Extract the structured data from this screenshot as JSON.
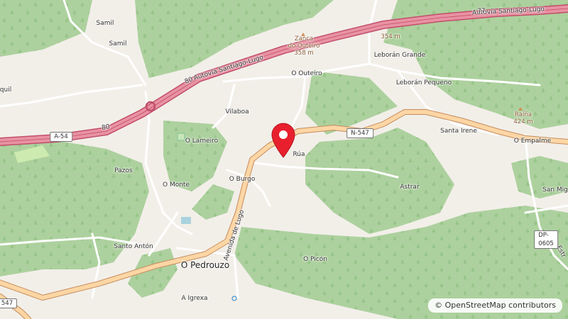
{
  "colors": {
    "background": "#f2efe9",
    "forest": "#add19e",
    "motorway": "#e892a2",
    "motorway_casing": "#c24e6b",
    "primary_road": "#fcd6a4",
    "primary_casing": "#c58d5f",
    "minor_road": "#ffffff",
    "water": "#aad3df",
    "marker": "#e8202e"
  },
  "labels": {
    "motorway_top": "Autovía Santiago-Lugo",
    "motorway_mid": "Autovía Santiago-Lugo",
    "avenue": "Avenida de Lugo",
    "places": {
      "samil_1": "Samil",
      "samil_2": "Samil",
      "left_edge": "quil",
      "vilaboa": "Vilaboa",
      "o_lameiro": "O Lameiro",
      "pazos": "Pazos",
      "o_monte": "O Monte",
      "o_burgo": "O Burgo",
      "santo_anton": "Santo Antón",
      "o_pedrouzo": "O Pedrouzo",
      "a_igrexa": "A Igrexa",
      "o_picon": "O Picón",
      "astrar": "Astrar",
      "rua": "Rúa",
      "o_outeiro": "O Outeiro",
      "leboran_grande": "Leborán Grande",
      "leboran_pequeno": "Leborán Pequeno",
      "santa_irene": "Santa Irene",
      "o_empalme": "O Empalme",
      "san_mig": "San Mig",
      "estr": "Estr"
    },
    "peaks": {
      "zanca_name_1": "Zanca",
      "zanca_name_2": "do Outeiro",
      "zanca_elev": "358 m",
      "unnamed_elev": "354 m",
      "raina_name": "Raíña",
      "raina_elev": "424 m"
    },
    "shields": {
      "a54": "A-54",
      "n547": "N-547",
      "dp0605": "DP-0605",
      "edge_547": "547"
    },
    "road_numbers": {
      "n77": "77",
      "n80a": "80",
      "n80b": "80"
    }
  },
  "attribution": "© OpenStreetMap contributors",
  "marker_icon": "map-pin-icon"
}
